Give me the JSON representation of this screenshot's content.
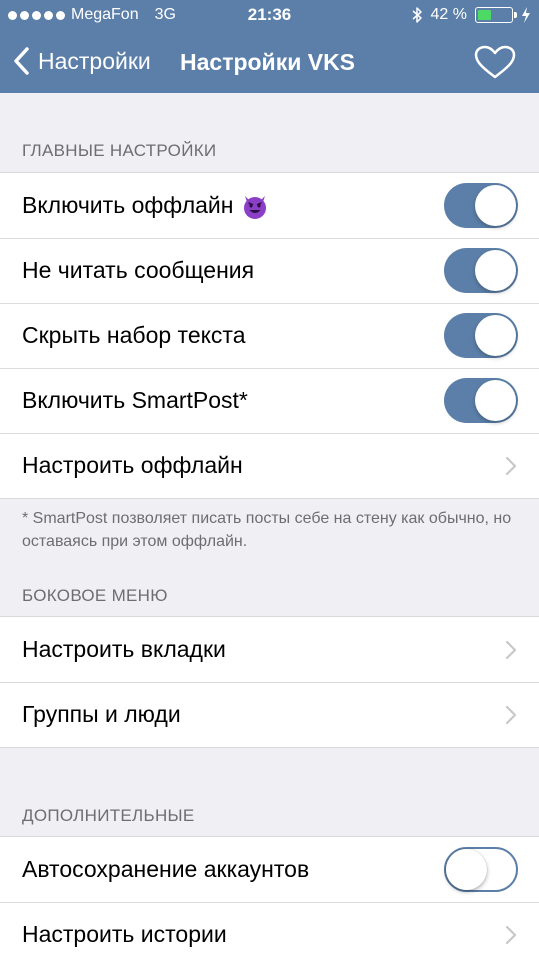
{
  "status": {
    "carrier": "MegaFon",
    "network": "3G",
    "time": "21:36",
    "battery_percent": "42 %",
    "battery_level": 0.42
  },
  "nav": {
    "back_label": "Настройки",
    "title": "Настройки VKS"
  },
  "sections": {
    "main": {
      "header": "ГЛАВНЫЕ НАСТРОЙКИ",
      "items": [
        {
          "label": "Включить оффлайн",
          "icon": "smiling-devil-emoji",
          "toggle": true
        },
        {
          "label": "Не читать сообщения",
          "toggle": true
        },
        {
          "label": "Скрыть набор текста",
          "toggle": true
        },
        {
          "label": "Включить SmartPost*",
          "toggle": true
        },
        {
          "label": "Настроить оффлайн",
          "icon": "chevron-right-icon"
        }
      ],
      "footnote": "* SmartPost позволяет писать посты себе на стену как обычно, но оставаясь при этом оффлайн."
    },
    "side_menu": {
      "header": "БОКОВОЕ МЕНЮ",
      "items": [
        {
          "label": "Настроить вкладки",
          "icon": "chevron-right-icon"
        },
        {
          "label": "Группы и люди",
          "icon": "chevron-right-icon"
        }
      ]
    },
    "extra": {
      "header": "ДОПОЛНИТЕЛЬНЫЕ",
      "items": [
        {
          "label": "Автосохранение аккаунтов",
          "toggle": false
        },
        {
          "label": "Настроить истории",
          "icon": "chevron-right-icon"
        }
      ]
    }
  },
  "colors": {
    "accent": "#5b7fa8",
    "background": "#efeff4",
    "battery_fill": "#4cd964",
    "secondary_text": "#6d6d72"
  }
}
